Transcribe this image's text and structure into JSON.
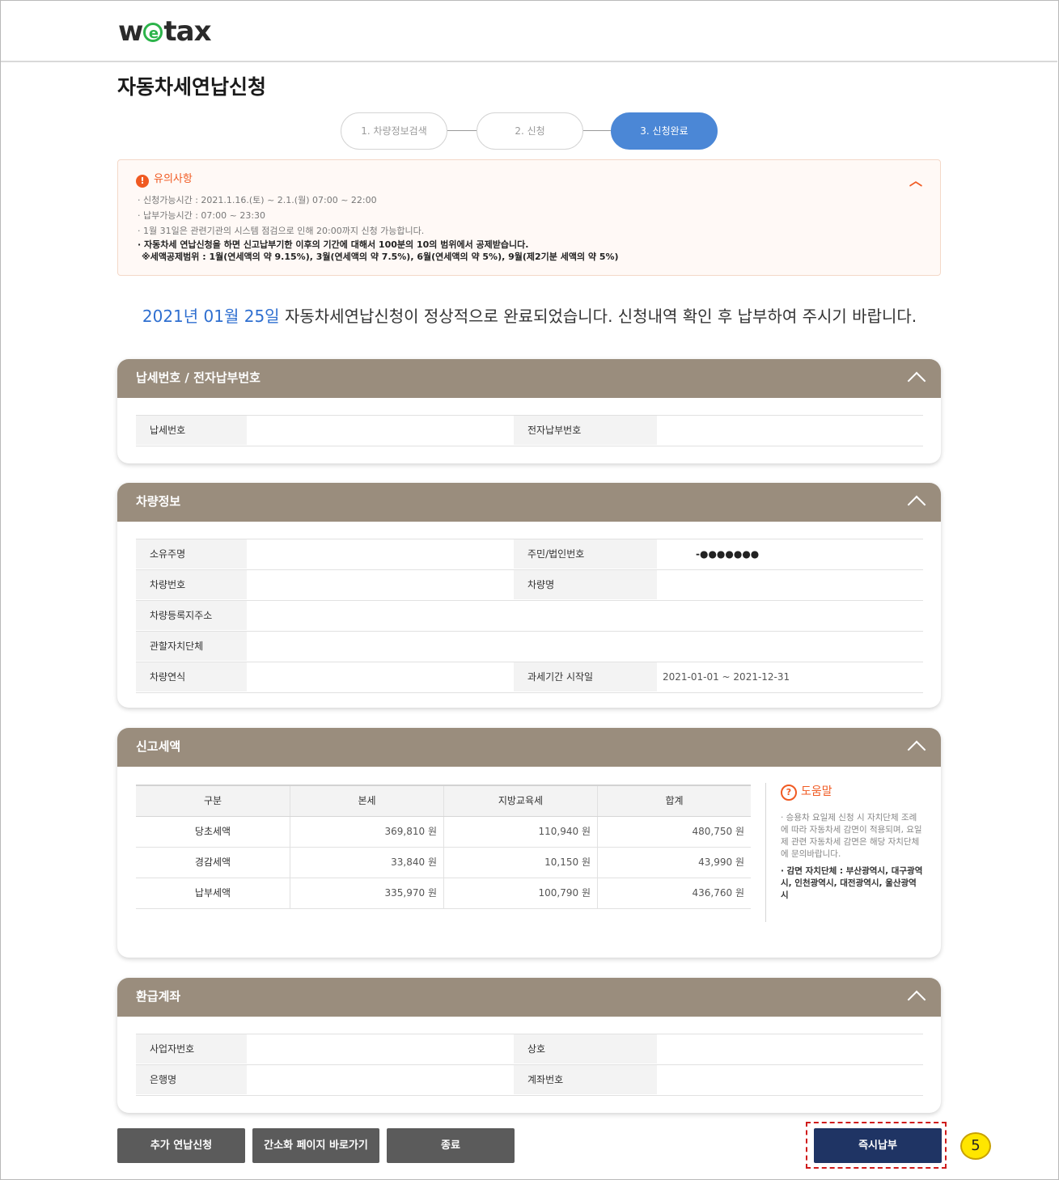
{
  "header": {
    "logo_pre": "w",
    "logo_e": "e",
    "logo_post": "tax"
  },
  "page_title": "자동차세연납신청",
  "steps": [
    "1. 차량정보검색",
    "2. 신청",
    "3. 신청완료"
  ],
  "notice": {
    "title": "유의사항",
    "items": [
      "· 신청가능시간 : 2021.1.16.(토) ~ 2.1.(월) 07:00 ~ 22:00",
      "· 납부가능시간 : 07:00 ~ 23:30",
      "· 1월 31일은 관련기관의 시스템 점검으로 인해 20:00까지 신청 가능합니다.",
      "· 자동차세 연납신청을 하면 신고납부기한 이후의 기간에 대해서 100분의 10의 범위에서 공제받습니다.",
      "※세액공제범위 : 1월(연세액의 약 9.15%), 3월(연세액의 약 7.5%), 6월(연세액의 약 5%), 9월(제2기분 세액의 약 5%)"
    ]
  },
  "done_message": {
    "date": "2021년 01월 25일",
    "text": " 자동차세연납신청이 정상적으로 완료되었습니다. 신청내역 확인 후 납부하여 주시기 바랍니다."
  },
  "tax_number_panel": {
    "title": "납세번호 / 전자납부번호",
    "rows": [
      {
        "l1": "납세번호",
        "v1": "",
        "l2": "전자납부번호",
        "v2": ""
      }
    ]
  },
  "vehicle_panel": {
    "title": "차량정보",
    "owner_label": "소유주명",
    "owner_value": "",
    "id_label": "주민/법인번호",
    "id_value": "-●●●●●●●",
    "car_no_label": "차량번호",
    "car_no_value": "",
    "car_name_label": "차량명",
    "car_name_value": "",
    "address_label": "차량등록지주소",
    "address_value": "",
    "gov_label": "관할자치단체",
    "gov_value": "",
    "year_label": "차량연식",
    "year_value": "",
    "period_label": "과세기간 시작일",
    "period_value": "2021-01-01 ~ 2021-12-31"
  },
  "tax_panel": {
    "title": "신고세액",
    "columns": [
      "구분",
      "본세",
      "지방교육세",
      "합계"
    ],
    "rows": [
      [
        "당초세액",
        "369,810 원",
        "110,940 원",
        "480,750 원"
      ],
      [
        "경감세액",
        "33,840 원",
        "10,150 원",
        "43,990 원"
      ],
      [
        "납부세액",
        "335,970 원",
        "100,790 원",
        "436,760 원"
      ]
    ],
    "help_title": "도움말",
    "help_text": "· 승용차 요일제 신청 시 자치단체 조례에 따라 자동차세 감면이 적용되며, 요일제 관련 자동차세 감면은 해당 자치단체에 문의바랍니다.",
    "help_text2": "· 감면 자치단체 : 부산광역시, 대구광역시, 인천광역시, 대전광역시, 울산광역시"
  },
  "refund_panel": {
    "title": "환급계좌",
    "biz_label": "사업자번호",
    "biz_value": "",
    "company_label": "상호",
    "company_value": "",
    "bank_label": "은행명",
    "bank_value": "",
    "account_label": "계좌번호",
    "account_value": ""
  },
  "buttons": {
    "add": "추가 연납신청",
    "simple": "간소화 페이지 바로가기",
    "close": "종료",
    "pay": "즉시납부"
  },
  "step_badge": "5"
}
